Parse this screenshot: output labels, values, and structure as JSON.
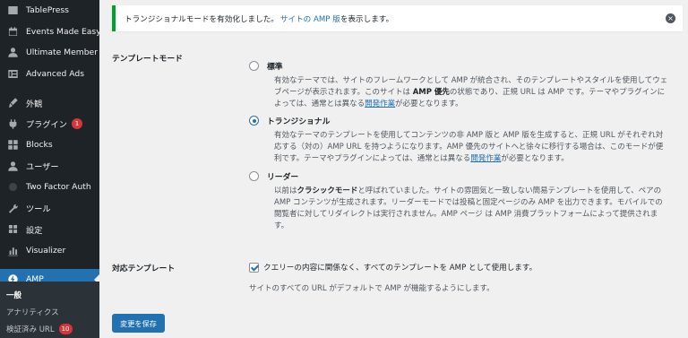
{
  "sidebar": {
    "items": [
      {
        "label": "TablePress",
        "icon": "table-icon"
      },
      {
        "label": "Events Made Easy",
        "icon": "calendar-icon"
      },
      {
        "label": "Ultimate Member",
        "icon": "user-icon"
      },
      {
        "label": "Advanced Ads",
        "icon": "ads-icon"
      },
      {
        "label": "外観",
        "icon": "brush-icon"
      },
      {
        "label": "プラグイン",
        "icon": "plugin-icon",
        "badge": "1"
      },
      {
        "label": "Blocks",
        "icon": "grid-icon"
      },
      {
        "label": "ユーザー",
        "icon": "user-icon"
      },
      {
        "label": "Two Factor Auth",
        "icon": "shield-icon"
      },
      {
        "label": "ツール",
        "icon": "wrench-icon"
      },
      {
        "label": "設定",
        "icon": "settings-icon"
      },
      {
        "label": "Visualizer",
        "icon": "chart-icon"
      },
      {
        "label": "AMP",
        "icon": "amp-icon"
      }
    ],
    "submenu": [
      {
        "label": "一般"
      },
      {
        "label": "アナリティクス"
      },
      {
        "label": "検証済み URL",
        "badge": "10"
      }
    ]
  },
  "notice": {
    "text": "トランジショナルモードを有効化しました。",
    "link": "サイトの AMP 版",
    "suffix": "を表示します。",
    "dismiss": "×"
  },
  "template_mode": {
    "label": "テンプレートモード",
    "options": [
      {
        "title": "標準",
        "checked": false,
        "desc1": "有効なテーマでは、サイトのフレームワークとして AMP が統合され、そのテンプレートやスタイルを使用してウェブページが表示されます。このサイトは ",
        "bold": "AMP 優先",
        "desc2": "の状態であり、正規 URL は AMP です。テーマやプラグインによっては、通常とは異なる",
        "link": "開発作業",
        "desc3": "が必要となります。"
      },
      {
        "title": "トランジショナル",
        "checked": true,
        "desc1": "有効なテーマのテンプレートを使用してコンテンツの非 AMP 版と AMP 版を生成すると、正規 URL がそれぞれ対応する（対の）AMP URL を持つようになります。AMP 優先のサイトへと徐々に移行する場合は、このモードが便利です。テーマやプラグインによっては、通常とは異なる",
        "link": "開発作業",
        "desc3": "が必要となります。"
      },
      {
        "title": "リーダー",
        "checked": false,
        "desc1": "以前は",
        "bold": "クラシックモード",
        "desc2": "と呼ばれていました。サイトの雰囲気と一致しない簡易テンプレートを使用して、ペアの AMP コンテンツが生成されます。リーダーモードでは投稿と固定ページのみ AMP を出力できます。モバイルでの閲覧者に対してリダイレクトは実行されません。AMP ページ は AMP 消費プラットフォームによって提供されます。"
      }
    ]
  },
  "supported_templates": {
    "label": "対応テンプレート",
    "checkbox_label": "クエリーの内容に関係なく、すべてのテンプレートを AMP として使用します。",
    "checked": true,
    "hint": "サイトのすべての URL がデフォルトで AMP が機能するようにします。"
  },
  "save_label": "変更を保存"
}
